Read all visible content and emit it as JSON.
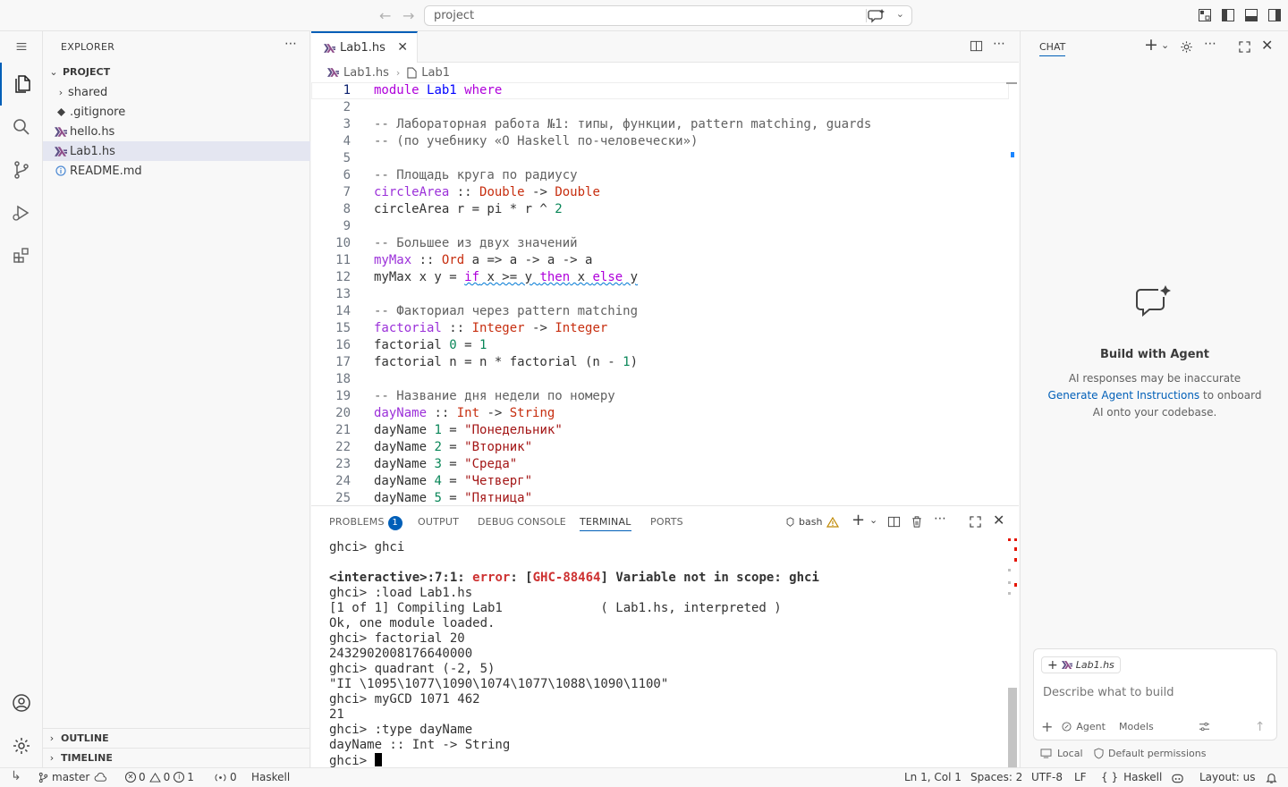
{
  "titlebar": {
    "search_label": "project"
  },
  "activitybar": {
    "items": [
      "explorer-icon",
      "search-icon",
      "source-control-icon",
      "run-debug-icon",
      "extensions-icon"
    ],
    "bottom": [
      "account-icon",
      "settings-gear-icon"
    ]
  },
  "sidebar": {
    "title": "EXPLORER",
    "root": "PROJECT",
    "items": [
      {
        "label": "shared",
        "type": "folder"
      },
      {
        "label": ".gitignore",
        "type": "file"
      },
      {
        "label": "hello.hs",
        "type": "haskell"
      },
      {
        "label": "Lab1.hs",
        "type": "haskell",
        "selected": true
      },
      {
        "label": "README.md",
        "type": "info"
      }
    ],
    "outline": "OUTLINE",
    "timeline": "TIMELINE"
  },
  "editor": {
    "tab_label": "Lab1.hs",
    "breadcrumb": [
      "Lab1.hs",
      "Lab1"
    ],
    "lines": [
      {
        "n": "1",
        "tokens": [
          [
            "kw",
            "module"
          ],
          [
            "op",
            " "
          ],
          [
            "mod",
            "Lab1"
          ],
          [
            "op",
            " "
          ],
          [
            "kw",
            "where"
          ]
        ]
      },
      {
        "n": "2",
        "tokens": []
      },
      {
        "n": "3",
        "tokens": [
          [
            "cm",
            "-- Лабораторная работа №1: типы, функции, pattern matching, guards"
          ]
        ]
      },
      {
        "n": "4",
        "tokens": [
          [
            "cm",
            "-- (по учебнику «О Haskell по-человечески»)"
          ]
        ]
      },
      {
        "n": "5",
        "tokens": []
      },
      {
        "n": "6",
        "tokens": [
          [
            "cm",
            "-- Площадь круга по радиусу"
          ]
        ]
      },
      {
        "n": "7",
        "tokens": [
          [
            "sig",
            "circleArea"
          ],
          [
            "op",
            " :: "
          ],
          [
            "ty",
            "Double"
          ],
          [
            "op",
            " -> "
          ],
          [
            "ty",
            "Double"
          ]
        ]
      },
      {
        "n": "8",
        "tokens": [
          [
            "dn",
            "circleArea r = pi * r ^ "
          ],
          [
            "num",
            "2"
          ]
        ]
      },
      {
        "n": "9",
        "tokens": []
      },
      {
        "n": "10",
        "tokens": [
          [
            "cm",
            "-- Большее из двух значений"
          ]
        ]
      },
      {
        "n": "11",
        "tokens": [
          [
            "sig",
            "myMax"
          ],
          [
            "op",
            " :: "
          ],
          [
            "ty",
            "Ord"
          ],
          [
            "op",
            " a => a -> a -> a"
          ]
        ]
      },
      {
        "n": "12",
        "tokens": [
          [
            "dn",
            "myMax x y = "
          ],
          [
            "sq",
            "if"
          ],
          [
            "sqd",
            " x >= y "
          ],
          [
            "sq",
            "then"
          ],
          [
            "sqd",
            " x "
          ],
          [
            "sq",
            "else"
          ],
          [
            "sqd",
            " y"
          ]
        ]
      },
      {
        "n": "13",
        "tokens": []
      },
      {
        "n": "14",
        "tokens": [
          [
            "cm",
            "-- Факториал через pattern matching"
          ]
        ]
      },
      {
        "n": "15",
        "tokens": [
          [
            "sig",
            "factorial"
          ],
          [
            "op",
            " :: "
          ],
          [
            "ty",
            "Integer"
          ],
          [
            "op",
            " -> "
          ],
          [
            "ty",
            "Integer"
          ]
        ]
      },
      {
        "n": "16",
        "tokens": [
          [
            "dn",
            "factorial "
          ],
          [
            "num",
            "0"
          ],
          [
            "op",
            " = "
          ],
          [
            "num",
            "1"
          ]
        ]
      },
      {
        "n": "17",
        "tokens": [
          [
            "dn",
            "factorial n = n * factorial (n - "
          ],
          [
            "num",
            "1"
          ],
          [
            "op",
            ")"
          ]
        ]
      },
      {
        "n": "18",
        "tokens": []
      },
      {
        "n": "19",
        "tokens": [
          [
            "cm",
            "-- Название дня недели по номеру"
          ]
        ]
      },
      {
        "n": "20",
        "tokens": [
          [
            "sig",
            "dayName"
          ],
          [
            "op",
            " :: "
          ],
          [
            "ty",
            "Int"
          ],
          [
            "op",
            " -> "
          ],
          [
            "ty",
            "String"
          ]
        ]
      },
      {
        "n": "21",
        "tokens": [
          [
            "dn",
            "dayName "
          ],
          [
            "num",
            "1"
          ],
          [
            "op",
            " = "
          ],
          [
            "str",
            "\"Понедельник\""
          ]
        ]
      },
      {
        "n": "22",
        "tokens": [
          [
            "dn",
            "dayName "
          ],
          [
            "num",
            "2"
          ],
          [
            "op",
            " = "
          ],
          [
            "str",
            "\"Вторник\""
          ]
        ]
      },
      {
        "n": "23",
        "tokens": [
          [
            "dn",
            "dayName "
          ],
          [
            "num",
            "3"
          ],
          [
            "op",
            " = "
          ],
          [
            "str",
            "\"Среда\""
          ]
        ]
      },
      {
        "n": "24",
        "tokens": [
          [
            "dn",
            "dayName "
          ],
          [
            "num",
            "4"
          ],
          [
            "op",
            " = "
          ],
          [
            "str",
            "\"Четверг\""
          ]
        ]
      },
      {
        "n": "25",
        "tokens": [
          [
            "dn",
            "dayName "
          ],
          [
            "num",
            "5"
          ],
          [
            "op",
            " = "
          ],
          [
            "str",
            "\"Пятница\""
          ]
        ]
      }
    ]
  },
  "panel": {
    "tabs": [
      {
        "label": "PROBLEMS",
        "badge": "1"
      },
      {
        "label": "OUTPUT"
      },
      {
        "label": "DEBUG CONSOLE"
      },
      {
        "label": "TERMINAL",
        "active": true
      },
      {
        "label": "PORTS"
      }
    ],
    "shell_label": "bash",
    "terminal_lines": [
      {
        "text": "ghci> ghci"
      },
      {
        "text": ""
      },
      {
        "err": true,
        "parts": [
          [
            "",
            "<interactive>:7:1: "
          ],
          [
            "red",
            "error"
          ],
          [
            "",
            ": ["
          ],
          [
            "red",
            "GHC-88464"
          ],
          [
            "",
            "] Variable not in scope: ghci"
          ]
        ]
      },
      {
        "text": "ghci> :load Lab1.hs"
      },
      {
        "text": "[1 of 1] Compiling Lab1             ( Lab1.hs, interpreted )"
      },
      {
        "text": "Ok, one module loaded."
      },
      {
        "text": "ghci> factorial 20"
      },
      {
        "text": "2432902008176640000"
      },
      {
        "text": "ghci> quadrant (-2, 5)"
      },
      {
        "text": "\"II \\1095\\1077\\1090\\1074\\1077\\1088\\1090\\1100\""
      },
      {
        "text": "ghci> myGCD 1071 462"
      },
      {
        "text": "21"
      },
      {
        "text": "ghci> :type dayName"
      },
      {
        "text": "dayName :: Int -> String"
      },
      {
        "text": "ghci> ",
        "cursor": true
      }
    ]
  },
  "chat": {
    "title": "CHAT",
    "heading": "Build with Agent",
    "desc_line1": "AI responses may be inaccurate",
    "desc_link": "Generate Agent Instructions",
    "desc_rest": " to onboard AI onto your codebase.",
    "context_file": "Lab1.hs",
    "input_placeholder": "Describe what to build",
    "mode": "Agent",
    "models": "Models",
    "local": "Local",
    "permissions": "Default permissions"
  },
  "statusbar": {
    "branch": "master",
    "errors": "0",
    "warnings": "0",
    "info": "1",
    "ports": "0",
    "language_left": "Haskell",
    "position": "Ln 1, Col 1",
    "spaces": "Spaces: 2",
    "encoding": "UTF-8",
    "eol": "LF",
    "language": "Haskell",
    "layout": "Layout: us"
  }
}
